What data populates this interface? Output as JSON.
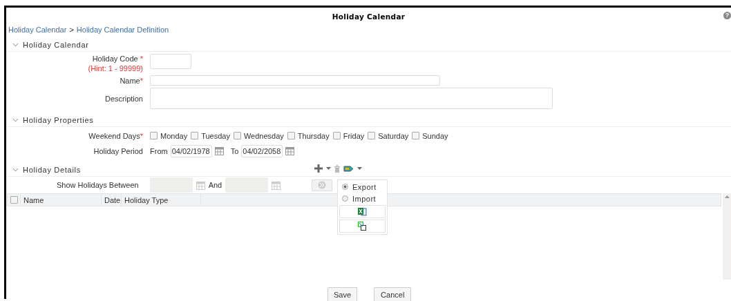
{
  "window": {
    "title": "Holiday Calendar",
    "help": "?"
  },
  "breadcrumb": {
    "items": [
      "Holiday Calendar",
      "Holiday Calendar Definition"
    ],
    "separator": ">"
  },
  "calendar_section": {
    "title": "Holiday Calendar",
    "expanded": true,
    "code": {
      "label": "Holiday Code",
      "required_mark": "*",
      "hint": "(Hint: 1 - 99999)"
    },
    "name": {
      "label": "Name",
      "required_mark": "*"
    },
    "description": {
      "label": "Description"
    }
  },
  "properties_section": {
    "title": "Holiday Properties",
    "expanded": true,
    "weekend": {
      "label": "Weekend Days",
      "required_mark": "*",
      "days": [
        {
          "label": "Monday",
          "checked": false
        },
        {
          "label": "Tuesday",
          "checked": false
        },
        {
          "label": "Wednesday",
          "checked": false
        },
        {
          "label": "Thursday",
          "checked": false
        },
        {
          "label": "Friday",
          "checked": false
        },
        {
          "label": "Saturday",
          "checked": false
        },
        {
          "label": "Sunday",
          "checked": false
        }
      ]
    },
    "period": {
      "label": "Holiday Period",
      "from_label": "From",
      "from": "04/02/1978",
      "to_label": "To",
      "to": "04/02/2058"
    }
  },
  "details_section": {
    "title": "Holiday Details",
    "expanded": true,
    "filter": {
      "label": "Show Holidays Between",
      "and_label": "And",
      "disabled": true
    },
    "table": {
      "all_checked": false,
      "columns": [
        "Name",
        "Date",
        "Holiday Type"
      ]
    },
    "menu": {
      "options": [
        {
          "label": "Export",
          "selected": true
        },
        {
          "label": "Import",
          "selected": false
        }
      ]
    }
  },
  "buttons": [
    "Save",
    "Cancel"
  ]
}
